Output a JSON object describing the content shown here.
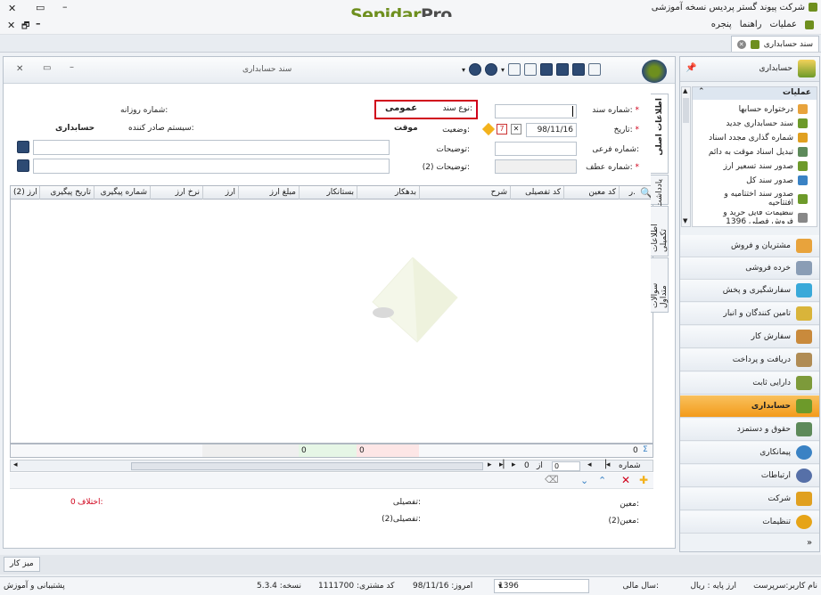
{
  "app": {
    "title": "شرکت پیوند گستر پردیس نسخه آموزشی",
    "logo_main": "Sepidar",
    "logo_suffix": "Pro",
    "menu": [
      "عملیات",
      "راهنما",
      "پنجره"
    ],
    "open_tab": "سند حسابداری"
  },
  "doc_window": {
    "title": "سند حسابداری"
  },
  "header_form": {
    "doc_number_label": "شماره سند:",
    "doc_type_label": "نوع سند:",
    "doc_type_value": "عمومی",
    "daily_number_label": "شماره روزانه:",
    "date_label": "تاریخ:",
    "date_value": "98/11/16",
    "status_label": "وضعیت:",
    "status_value": "موقت",
    "issuer_label": "سیستم صادر کننده:",
    "issuer_value": "حسابداری",
    "sub_number_label": "شماره فرعی:",
    "description_label": "توضیحات:",
    "ref_number_label": "شماره عطف:",
    "description2_label": "توضیحات (2):",
    "required_mark": "*"
  },
  "grid": {
    "columns": [
      "ر.",
      "کد معین",
      "کد تفصیلی",
      "شرح",
      "بدهکار",
      "بستانکار",
      "مبلغ ارز",
      "ارز",
      "نرخ ارز",
      "شماره پیگیری",
      "تاریخ پیگیری",
      "ارز (2)"
    ],
    "footer": {
      "count": "0",
      "debit_total": "0",
      "credit_total": "0"
    },
    "nav": {
      "row_label": "شماره",
      "of_label": "از",
      "current": "0",
      "total": "0"
    }
  },
  "vertical_tabs": [
    "اطلاعات اصلی",
    "یادداشت",
    "اطلاعات تکمیلی",
    "سوالات متداول"
  ],
  "footer_form": {
    "moein_label": "معین:",
    "tafsili_label": "تفصیلی:",
    "difference_label": "اختلاف:",
    "difference_value": "0",
    "moein2_label": "معین(2):",
    "tafsili2_label": "تفصیلی(2):"
  },
  "side_panel": {
    "module_title": "حسابداری",
    "ops_title": "عملیات",
    "ops_items": [
      "درختواره حسابها",
      "سند حسابداری جدید",
      "شماره گذاری مجدد اسناد",
      "تبدیل اسناد موقت به دائم",
      "صدور سند تسعیر ارز",
      "صدور سند کل",
      "صدور سند اختتامیه و افتتاحیه",
      "تنظیمات فایل خرید و فروش فصلی 1396"
    ],
    "modules": [
      {
        "label": "مشتریان و فروش",
        "color": "#e8a33c"
      },
      {
        "label": "خرده فروشی",
        "color": "#8a9db5"
      },
      {
        "label": "سفارشگیری و پخش",
        "color": "#39a9d9"
      },
      {
        "label": "تامین کنندگان و انبار",
        "color": "#d9b43a"
      },
      {
        "label": "سفارش کار",
        "color": "#c98a3c"
      },
      {
        "label": "دریافت و پرداخت",
        "color": "#b08c55"
      },
      {
        "label": "دارایی ثابت",
        "color": "#7d9a3a"
      },
      {
        "label": "حسابداری",
        "color": "#6d9a2a"
      },
      {
        "label": "حقوق و دستمزد",
        "color": "#5d8a5a"
      },
      {
        "label": "پیمانکاری",
        "color": "#3a82c4"
      },
      {
        "label": "ارتباطات",
        "color": "#5670a8"
      },
      {
        "label": "شرکت",
        "color": "#e0a020"
      },
      {
        "label": "تنظیمات",
        "color": "#e6a418"
      }
    ]
  },
  "taskbar": {
    "desktop": "میز کار"
  },
  "status": {
    "username": "نام کاربر:سرپرست",
    "base_currency": "ارز پایه : ریال",
    "fiscal_year_label": "سال مالی:",
    "fiscal_year": "1396",
    "today": "امروز:   98/11/16",
    "customer_code": "کد مشتری:   1111700",
    "version": "نسخه:   5.3.4",
    "support": "پشتیبانی و آموزش"
  },
  "colors": {
    "accent_orange": "#f39b1b",
    "highlight_red": "#d0021b",
    "logo_green": "#6e8f1e"
  }
}
